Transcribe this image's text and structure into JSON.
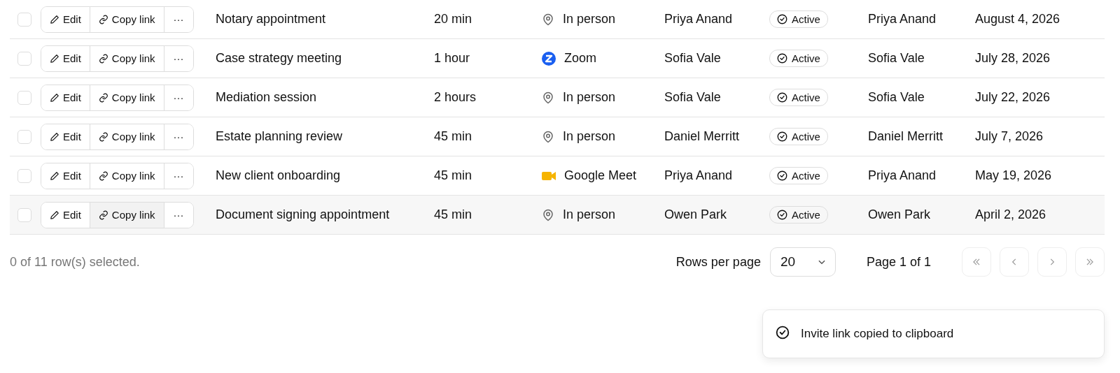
{
  "table": {
    "rows": [
      {
        "checked": false,
        "highlighted": false,
        "actions": {
          "edit": "Edit",
          "copy": "Copy link",
          "more": "···"
        },
        "name": "Notary appointment",
        "duration": "20 min",
        "location": {
          "kind": "in_person",
          "label": "In person"
        },
        "host": "Priya Anand",
        "status": "Active",
        "owner": "Priya Anand",
        "date": "August 4, 2026"
      },
      {
        "checked": false,
        "highlighted": false,
        "actions": {
          "edit": "Edit",
          "copy": "Copy link",
          "more": "···"
        },
        "name": "Case strategy meeting",
        "duration": "1 hour",
        "location": {
          "kind": "zoom",
          "label": "Zoom"
        },
        "host": "Sofia Vale",
        "status": "Active",
        "owner": "Sofia Vale",
        "date": "July 28, 2026"
      },
      {
        "checked": false,
        "highlighted": false,
        "actions": {
          "edit": "Edit",
          "copy": "Copy link",
          "more": "···"
        },
        "name": "Mediation session",
        "duration": "2 hours",
        "location": {
          "kind": "in_person",
          "label": "In person"
        },
        "host": "Sofia Vale",
        "status": "Active",
        "owner": "Sofia Vale",
        "date": "July 22, 2026"
      },
      {
        "checked": false,
        "highlighted": false,
        "actions": {
          "edit": "Edit",
          "copy": "Copy link",
          "more": "···"
        },
        "name": "Estate planning review",
        "duration": "45 min",
        "location": {
          "kind": "in_person",
          "label": "In person"
        },
        "host": "Daniel Merritt",
        "status": "Active",
        "owner": "Daniel Merritt",
        "date": "July 7, 2026"
      },
      {
        "checked": false,
        "highlighted": false,
        "actions": {
          "edit": "Edit",
          "copy": "Copy link",
          "more": "···"
        },
        "name": "New client onboarding",
        "duration": "45 min",
        "location": {
          "kind": "google_meet",
          "label": "Google Meet"
        },
        "host": "Priya Anand",
        "status": "Active",
        "owner": "Priya Anand",
        "date": "May 19, 2026"
      },
      {
        "checked": false,
        "highlighted": true,
        "actions": {
          "edit": "Edit",
          "copy": "Copy link",
          "more": "···"
        },
        "name": "Document signing appointment",
        "duration": "45 min",
        "location": {
          "kind": "in_person",
          "label": "In person"
        },
        "host": "Owen Park",
        "status": "Active",
        "owner": "Owen Park",
        "date": "April 2, 2026"
      }
    ]
  },
  "footer": {
    "selection": "0 of 11 row(s) selected.",
    "rows_per_page_label": "Rows per page",
    "rows_per_page": "20",
    "page": "Page 1 of 1"
  },
  "toast": {
    "message": "Invite link copied to clipboard"
  }
}
